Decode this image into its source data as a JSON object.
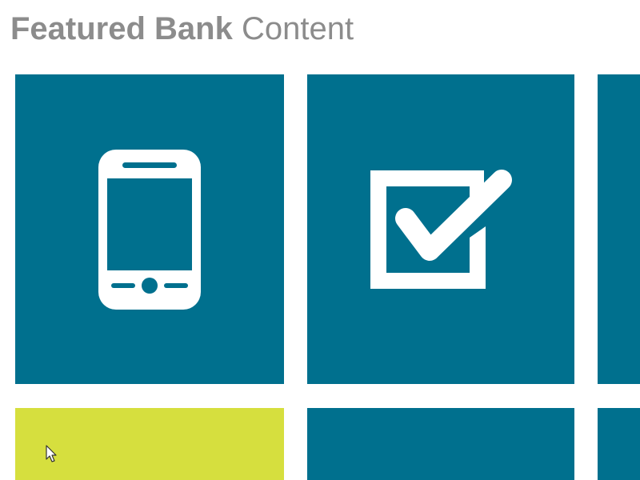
{
  "header": {
    "title_bold": "Featured Bank",
    "title_light": "Content"
  },
  "colors": {
    "title_text": "#8c8c8c",
    "tile_teal": "#00708e",
    "tile_lime": "#d6df3e",
    "icon_white": "#ffffff"
  },
  "tiles": [
    {
      "name": "mobile-tile",
      "icon": "smartphone-icon",
      "color": "#00708e"
    },
    {
      "name": "checkbox-tile",
      "icon": "checkbox-checked-icon",
      "color": "#00708e"
    },
    {
      "name": "partial-tile-right-top",
      "icon": "",
      "color": "#00708e"
    },
    {
      "name": "lime-tile",
      "icon": "",
      "color": "#d6df3e"
    },
    {
      "name": "teal-tile-bottom-middle",
      "icon": "",
      "color": "#00708e"
    },
    {
      "name": "partial-tile-right-bottom",
      "icon": "",
      "color": "#00708e"
    }
  ],
  "cursor": {
    "icon": "mouse-pointer-icon"
  }
}
